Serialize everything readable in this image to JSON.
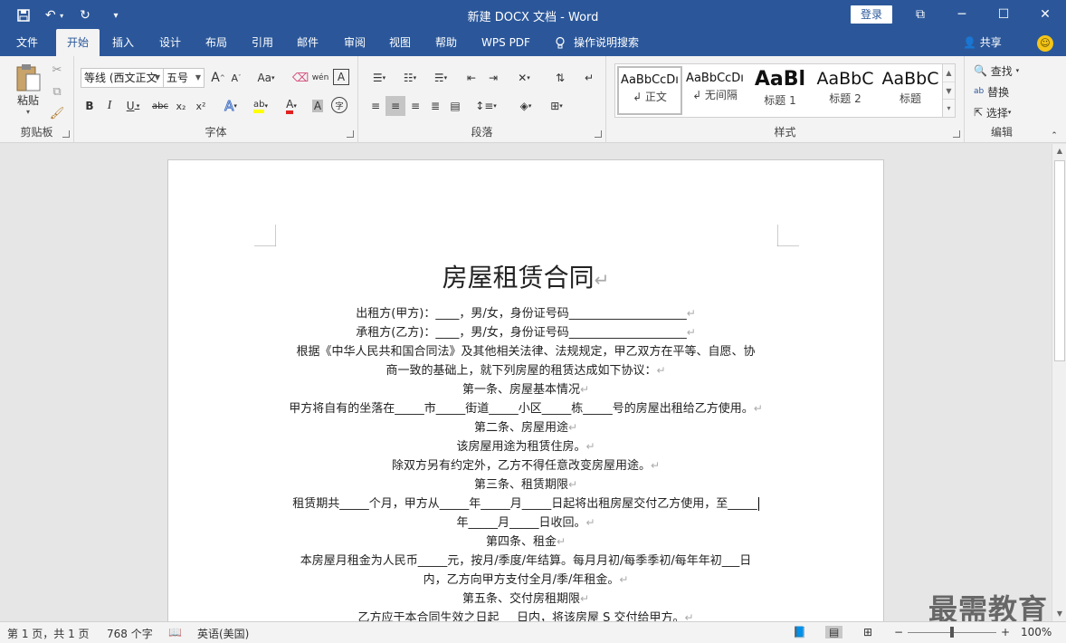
{
  "window": {
    "title": "新建 DOCX 文档  -  Word",
    "login_label": "登录",
    "controls": {
      "restore": "⧉",
      "minimize": "─",
      "maximize": "☐",
      "close": "✕"
    }
  },
  "qat": {
    "save": "💾",
    "undo": "↶",
    "redo": "↻",
    "customize": "▾"
  },
  "tabs": [
    {
      "label": "文件"
    },
    {
      "label": "开始"
    },
    {
      "label": "插入"
    },
    {
      "label": "设计"
    },
    {
      "label": "布局"
    },
    {
      "label": "引用"
    },
    {
      "label": "邮件"
    },
    {
      "label": "审阅"
    },
    {
      "label": "视图"
    },
    {
      "label": "帮助"
    },
    {
      "label": "WPS PDF"
    },
    {
      "label": "操作说明搜索"
    }
  ],
  "share_label": "共享",
  "ribbon": {
    "clipboard": {
      "label": "剪贴板",
      "paste": "粘贴"
    },
    "font": {
      "label": "字体",
      "font_name": "等线 (西文正文",
      "font_size": "五号",
      "bold": "B",
      "italic": "I",
      "underline": "U",
      "strike": "abc",
      "sub": "x₂",
      "sup": "x²",
      "grow": "A",
      "shrink": "A",
      "case": "Aa",
      "wen": "wén",
      "boxA": "A",
      "texteffect": "A",
      "highlight": "ab",
      "fontcolor": "A",
      "shadeA": "A",
      "circle": "字"
    },
    "paragraph": {
      "label": "段落"
    },
    "styles": {
      "label": "样式",
      "items": [
        {
          "sample": "AaBbCcDı",
          "name": "↲ 正文"
        },
        {
          "sample": "AaBbCcDı",
          "name": "↲ 无间隔"
        },
        {
          "sample": "AaBl",
          "name": "标题 1"
        },
        {
          "sample": "AaBbC",
          "name": "标题 2"
        },
        {
          "sample": "AaBbC",
          "name": "标题"
        }
      ]
    },
    "editing": {
      "label": "编辑",
      "find": "查找",
      "replace": "替换",
      "select": "选择"
    }
  },
  "document": {
    "title": "房屋租赁合同",
    "lines": [
      "出租方(甲方)：____，男/女，身份证号码____________________",
      "承租方(乙方)：____，男/女，身份证号码____________________",
      "根据《中华人民共和国合同法》及其他相关法律、法规规定，甲乙双方在平等、自愿、协",
      "商一致的基础上，就下列房屋的租赁达成如下协议：",
      "第一条、房屋基本情况",
      "甲方将自有的坐落在_____市_____街道_____小区_____栋_____号的房屋出租给乙方使用。",
      "第二条、房屋用途",
      "该房屋用途为租赁住房。",
      "除双方另有约定外，乙方不得任意改变房屋用途。",
      "第三条、租赁期限",
      "租赁期共_____个月，甲方从_____年_____月_____日起将出租房屋交付乙方使用，至_____",
      "年_____月_____日收回。",
      "第四条、租金",
      "本房屋月租金为人民币_____元，按月/季度/年结算。每月月初/每季季初/每年年初___日",
      "内，乙方向甲方支付全月/季/年租金。",
      "第五条、交付房租期限",
      "乙方应于本合同生效之日起___日内，将该房屋 S 交付给甲方。"
    ]
  },
  "watermark": "最需教育",
  "status": {
    "page": "第 1 页，共 1 页",
    "words": "768 个字",
    "language": "英语(美国)",
    "zoom": "100%"
  },
  "colors": {
    "accent": "#2b579a"
  }
}
